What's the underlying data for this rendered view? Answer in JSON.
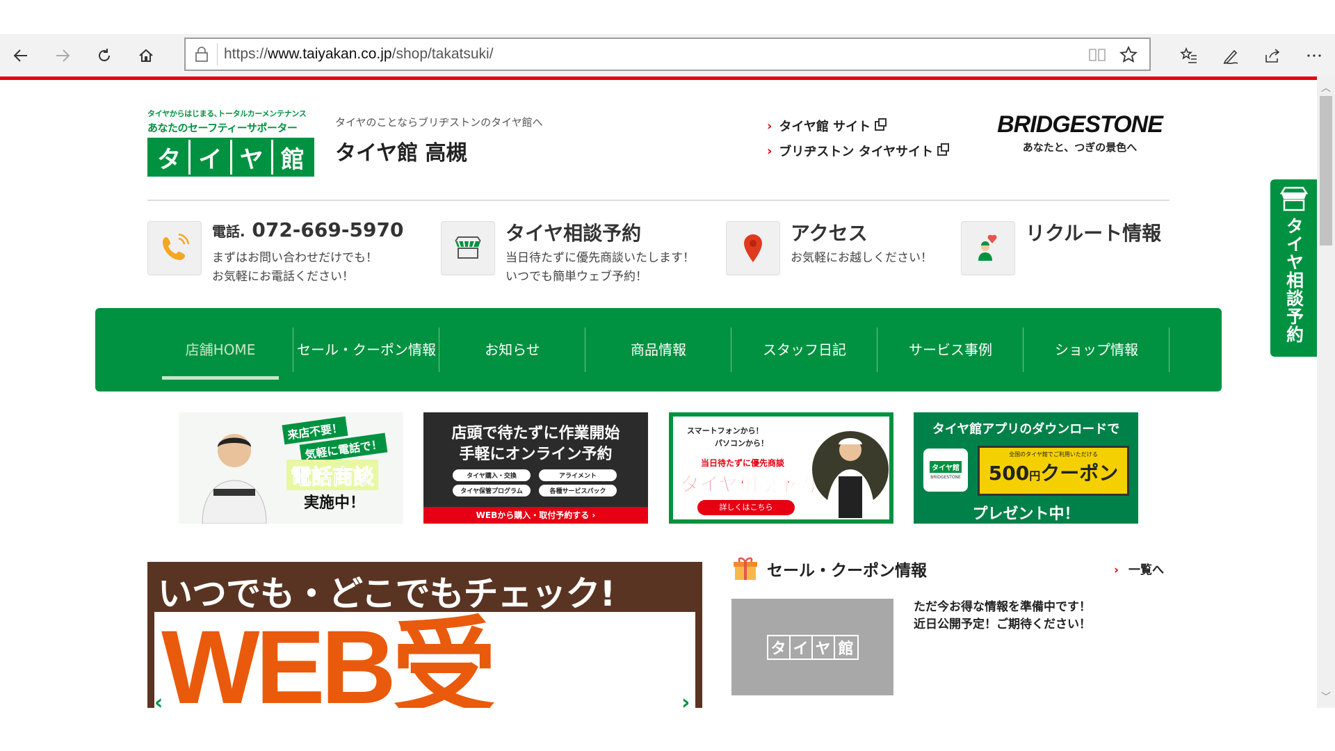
{
  "browser": {
    "url_prefix": "https://",
    "url_host": "www.taiyakan.co.jp",
    "url_path": "/shop/takatsuki/"
  },
  "header": {
    "logo_tagline": "タイヤからはじまる､トータルカーメンテナンス",
    "logo_subtitle": "あなたのセーフティーサポーター",
    "logo_chars": [
      "タ",
      "イ",
      "ヤ",
      "館"
    ],
    "store_sub": "タイヤのことならブリヂストンのタイヤ館へ",
    "store_name": "タイヤ館 高槻",
    "links": [
      "タイヤ館 サイト",
      "ブリヂストン タイヤサイト"
    ],
    "brand": "BRIDGESTONE",
    "brand_slogan": "あなたと、つぎの景色へ"
  },
  "info": {
    "phone_label": "電話.",
    "phone_number": "072-669-5970",
    "phone_desc1": "まずはお問い合わせだけでも！",
    "phone_desc2": "お気軽にお電話ください！",
    "consult_title": "タイヤ相談予約",
    "consult_desc1": "当日待たずに優先商談いたします！",
    "consult_desc2": "いつでも簡単ウェブ予約！",
    "access_title": "アクセス",
    "access_desc": "お気軽にお越しください！",
    "recruit_title": "リクルート情報"
  },
  "nav": {
    "items": [
      "店舗HOME",
      "セール・クーポン情報",
      "お知らせ",
      "商品情報",
      "スタッフ日記",
      "サービス事例",
      "ショップ情報"
    ]
  },
  "banners": {
    "b1": {
      "tag1": "来店不要！",
      "tag2": "気軽に電話で！",
      "big": "電話商談",
      "sub": "実施中！"
    },
    "b2": {
      "line1": "店頭で待たずに作業開始",
      "line2": "手軽にオンライン予約",
      "pills": [
        "タイヤ購入・交換",
        "アライメント",
        "タイヤ保管プログラム",
        "各種サービスパック"
      ],
      "cta": "WEBから購入・取付予約する ›"
    },
    "b3": {
      "m1": "スマートフォンから！",
      "m2": "パソコンから！",
      "m3": "当日待たずに優先商談",
      "m4": "タイヤ相談予約",
      "m5": "詳しくはこちら"
    },
    "b4": {
      "t1": "タイヤ館アプリのダウンロードで",
      "app1": "タイヤ館",
      "app2": "BRIDGESTONE",
      "c1": "全国のタイヤ館でご利用いただける",
      "c2_num": "500",
      "c2_yen": "円",
      "c2_word": "クーポン",
      "t2": "プレゼント中！"
    }
  },
  "slider": {
    "line1": "いつでも・どこでもチェック!",
    "line2": "WEB受",
    "prev": "‹",
    "next": "›"
  },
  "sale": {
    "title": "セール・クーポン情報",
    "more": "一覧へ",
    "placeholder_chars": [
      "タ",
      "イ",
      "ヤ",
      "館"
    ],
    "text1": "ただ今お得な情報を準備中です！",
    "text2": "近日公開予定！ご期待ください！"
  },
  "sidetab": {
    "label": "タイヤ相談予約"
  }
}
